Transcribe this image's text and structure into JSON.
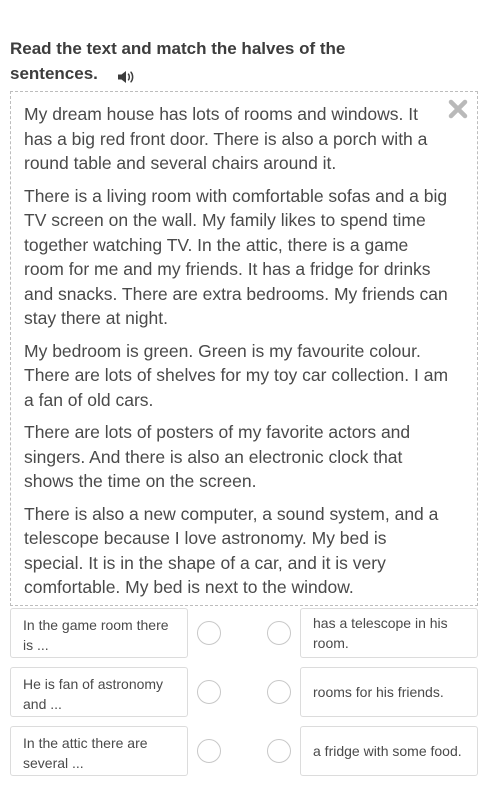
{
  "instruction": {
    "title": "Read the text and match the halves of the sentences."
  },
  "icons": {
    "speaker": "speaker-icon",
    "close": "close-icon",
    "accent": "#b9b9b9"
  },
  "text": {
    "paragraphs": [
      "My dream house has lots of rooms and windows. It has a big red front door. There is also a porch with a round table and several chairs around it.",
      "There is a living room with comfortable sofas and a big TV screen on the wall. My family likes to spend time together watching TV. In the attic, there is a game room for me and my friends. It has a fridge for drinks and snacks. There are extra bedrooms. My friends can stay there at night.",
      "My bedroom is green. Green is my favourite colour. There are lots of shelves for my toy car collection. I am a fan of old cars.",
      "There are lots of posters of my favorite actors and singers. And there is also an electronic clock that shows the time on the screen.",
      "There is also a new computer, a sound system, and a telescope because I love astronomy. My bed is special. It is in the shape of a car, and it is very comfortable. My bed is next to the window."
    ]
  },
  "matching": {
    "left": [
      "In the game room there is ...",
      "He is fan of astronomy and ...",
      "In the attic there are several ..."
    ],
    "right": [
      "has a telescope in his room.",
      "rooms for his friends.",
      "a fridge with some food."
    ]
  }
}
